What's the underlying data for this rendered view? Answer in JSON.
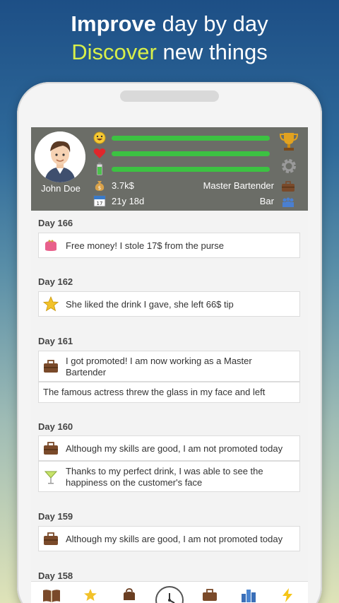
{
  "headline": {
    "line1_bold": "Improve",
    "line1_rest": " day by day",
    "line2_accent": "Discover",
    "line2_rest": " new things"
  },
  "player": {
    "name": "John Doe",
    "money": "3.7k$",
    "age": "21y 18d",
    "job": "Master Bartender",
    "place": "Bar",
    "stat_bars": [
      "happiness",
      "health",
      "energy"
    ],
    "bar_color": "#3cc242"
  },
  "feed": [
    {
      "day": "Day 166",
      "events": [
        {
          "icon": "purse-icon",
          "text": "Free money! I stole 17$ from the purse"
        }
      ]
    },
    {
      "day": "Day 162",
      "events": [
        {
          "icon": "star-icon",
          "text": "She liked the drink I gave, she left 66$ tip"
        }
      ]
    },
    {
      "day": "Day 161",
      "events": [
        {
          "icon": "briefcase-icon",
          "text": "I got promoted! I am now working as a Master Bartender"
        },
        {
          "icon": "",
          "text": "The famous actress threw the glass in my face and left"
        }
      ]
    },
    {
      "day": "Day 160",
      "events": [
        {
          "icon": "briefcase-icon",
          "text": "Although my skills are good, I am not promoted today"
        },
        {
          "icon": "cocktail-icon",
          "text": "Thanks to my perfect drink, I was able to see the happiness on the customer's face"
        }
      ]
    },
    {
      "day": "Day 159",
      "events": [
        {
          "icon": "briefcase-icon",
          "text": "Although my skills are good, I am not promoted today"
        }
      ]
    },
    {
      "day": "Day 158",
      "events": []
    }
  ],
  "nav": [
    "book-icon",
    "star-icon",
    "bag-icon",
    "clock-icon",
    "briefcase-icon",
    "city-icon",
    "lightning-icon"
  ]
}
